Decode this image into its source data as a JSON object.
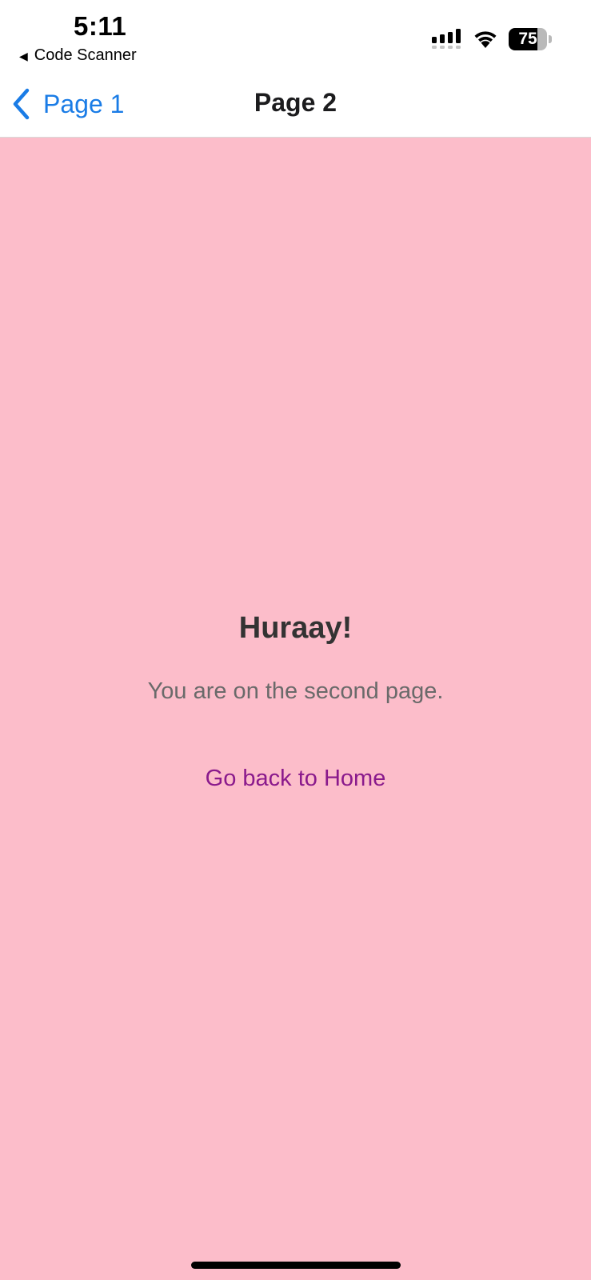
{
  "status_bar": {
    "time": "5:11",
    "back_app_label": "Code Scanner",
    "battery_percent": "75",
    "battery_level": 0.75
  },
  "nav": {
    "back_label": "Page 1",
    "title": "Page 2",
    "accent_color": "#1a7ce6"
  },
  "content": {
    "background_color": "#fcbdca",
    "heading": "Huraay!",
    "subtitle": "You are on the second page.",
    "home_link": "Go back to Home",
    "link_color": "#8a1a8c"
  }
}
